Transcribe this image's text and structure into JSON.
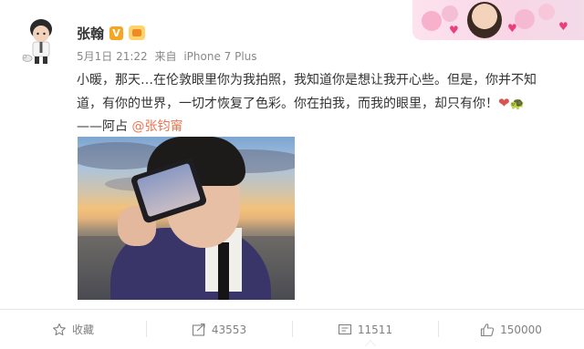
{
  "post": {
    "author": "张翰",
    "verified_badge": "V",
    "date": "5月1日 21:22",
    "source_prefix": "来自",
    "source": "iPhone 7 Plus",
    "text_line1": "小暖，那天…在伦敦眼里你为我拍照，我知道你是想让我开心些。但是，你并不知",
    "text_line2": "道，有你的世界，一切才恢复了色彩。你在拍我，而我的眼里，却只有你！",
    "text_line3_prefix": "——阿占 ",
    "mention": "@张钧甯",
    "emoji_heart": "❤",
    "emoji_turtle": "🐢"
  },
  "actions": {
    "favorite_label": "收藏",
    "repost_count": "43553",
    "comment_count": "11511",
    "like_count": "150000"
  },
  "colors": {
    "mention": "#eb7350",
    "badge": "#f5a623",
    "muted": "#808080"
  },
  "icons": {
    "favorite": "star-icon",
    "repost": "repost-icon",
    "comment": "comment-icon",
    "like": "thumbs-up-icon"
  }
}
